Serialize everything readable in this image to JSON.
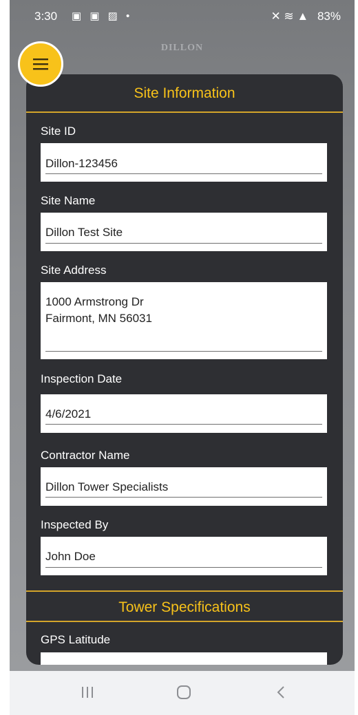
{
  "status_bar": {
    "time": "3:30",
    "left_icons": "▣ ▣ ▨ •",
    "right_icons": "✕ ≋ ▲",
    "battery": "83%"
  },
  "header": {
    "brand": "DILLON"
  },
  "sections": [
    {
      "title": "Site Information"
    },
    {
      "title": "Tower Specifications"
    }
  ],
  "fields": {
    "site_id": {
      "label": "Site ID",
      "value": "Dillon-123456"
    },
    "site_name": {
      "label": "Site Name",
      "value": "Dillon Test Site"
    },
    "site_address": {
      "label": "Site Address",
      "value": "1000 Armstrong Dr\nFairmont, MN 56031"
    },
    "inspection_date": {
      "label": "Inspection Date",
      "value": "4/6/2021"
    },
    "contractor_name": {
      "label": "Contractor Name",
      "value": "Dillon Tower Specialists"
    },
    "inspected_by": {
      "label": "Inspected By",
      "value": "John Doe"
    },
    "gps_latitude": {
      "label": "GPS Latitude",
      "value": ""
    }
  },
  "colors": {
    "accent": "#f8c21a",
    "panel": "#2e2f33",
    "divider": "#d4a52a"
  },
  "icons": {
    "menu": "hamburger-menu-icon",
    "recents": "recent-apps-icon",
    "home": "home-icon",
    "back": "back-icon"
  }
}
